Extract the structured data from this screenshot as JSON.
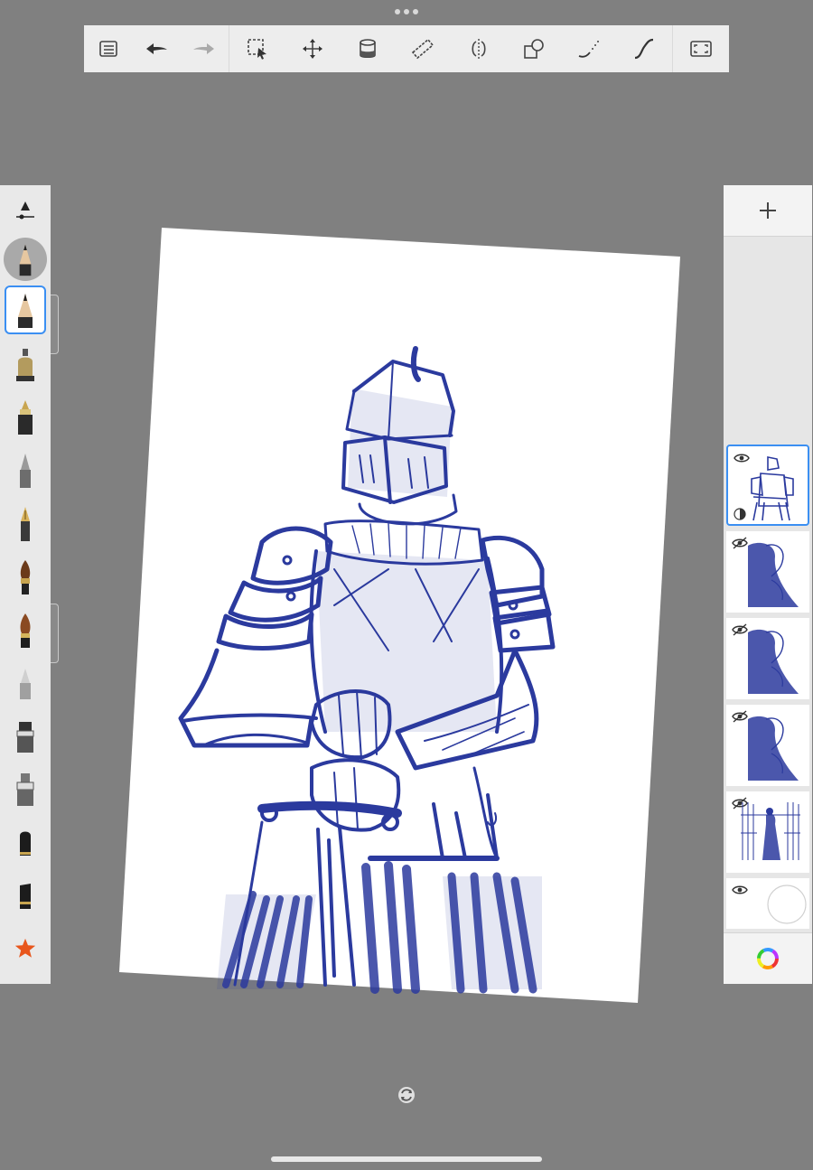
{
  "toolbar": {
    "left_buttons": [
      "list-icon",
      "undo-icon",
      "redo-icon"
    ],
    "tools": [
      "selection-icon",
      "transform-icon",
      "fill-bucket-icon",
      "ruler-icon",
      "symmetry-icon",
      "shapes-icon",
      "predictive-stroke-icon",
      "steady-stroke-icon"
    ],
    "right_buttons": [
      "fullscreen-icon"
    ]
  },
  "brushes": {
    "selected_index": 0,
    "items": [
      "pencil-icon",
      "airbrush-icon",
      "inking-pen-icon",
      "ballpoint-icon",
      "fountain-pen-icon",
      "paintbrush-icon",
      "round-brush-icon",
      "eraser-icon",
      "marker-icon",
      "wide-marker-icon",
      "stamp-icon",
      "chisel-icon",
      "favorites-star-icon"
    ]
  },
  "layers": {
    "items": [
      {
        "name": "layer-knight",
        "visible": true,
        "active": true
      },
      {
        "name": "layer-figure-1",
        "visible": false,
        "active": false
      },
      {
        "name": "layer-figure-2",
        "visible": false,
        "active": false
      },
      {
        "name": "layer-figure-3",
        "visible": false,
        "active": false
      },
      {
        "name": "layer-crowd",
        "visible": false,
        "active": false
      },
      {
        "name": "layer-background",
        "visible": true,
        "active": false
      }
    ]
  },
  "colors": {
    "panel": "#e9e9e9",
    "accent": "#3b8ff2",
    "ink": "#2b3a9e",
    "background": "#808080"
  }
}
